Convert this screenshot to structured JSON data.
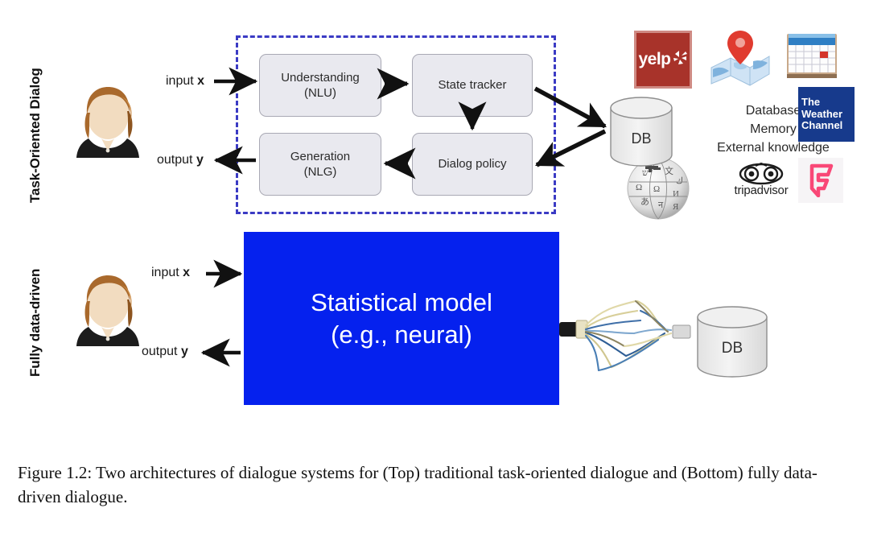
{
  "figure": {
    "caption": "Figure 1.2: Two architectures of dialogue systems for (Top) traditional task-oriented dialogue and (Bottom) fully data-driven dialogue."
  },
  "sections": {
    "top_label": "Task-Oriented Dialog",
    "bottom_label": "Fully data-driven"
  },
  "io": {
    "input_label": "input",
    "input_var": "x",
    "output_label": "output",
    "output_var": "y"
  },
  "pipeline": {
    "boxes": [
      {
        "id": "nlu",
        "line1": "Understanding",
        "line2": "(NLU)"
      },
      {
        "id": "state_tracker",
        "line1": "State tracker",
        "line2": ""
      },
      {
        "id": "nlg",
        "line1": "Generation",
        "line2": "(NLG)"
      },
      {
        "id": "dialog_policy",
        "line1": "Dialog policy",
        "line2": ""
      }
    ]
  },
  "model": {
    "line1": "Statistical model",
    "line2": "(e.g., neural)"
  },
  "knowledge": {
    "lines": [
      "Database",
      "Memory",
      "External knowledge"
    ],
    "line1": "Database",
    "line2": "Memory",
    "line3": "External knowledge"
  },
  "database": {
    "top_label": "DB",
    "bottom_label": "DB"
  },
  "logos": [
    {
      "name": "yelp",
      "text": "yelp"
    },
    {
      "name": "maps",
      "text": ""
    },
    {
      "name": "calendar",
      "text": ""
    },
    {
      "name": "weather-channel",
      "text": "The Weather Channel"
    },
    {
      "name": "wikipedia",
      "text": ""
    },
    {
      "name": "tripadvisor",
      "text": "tripadvisor"
    },
    {
      "name": "foursquare",
      "text": ""
    }
  ],
  "logo_text": {
    "yelp": "yelp",
    "weather_l1": "The",
    "weather_l2": "Weather",
    "weather_l3": "Channel",
    "tripadvisor": "tripadvisor"
  },
  "colors": {
    "model_blue": "#0521EE",
    "dashed_border": "#3b3bc4",
    "box_fill": "#e9e9ef",
    "yelp_red": "#a8332a",
    "weather_navy": "#173a8c",
    "foursquare_pink": "#f94877"
  }
}
